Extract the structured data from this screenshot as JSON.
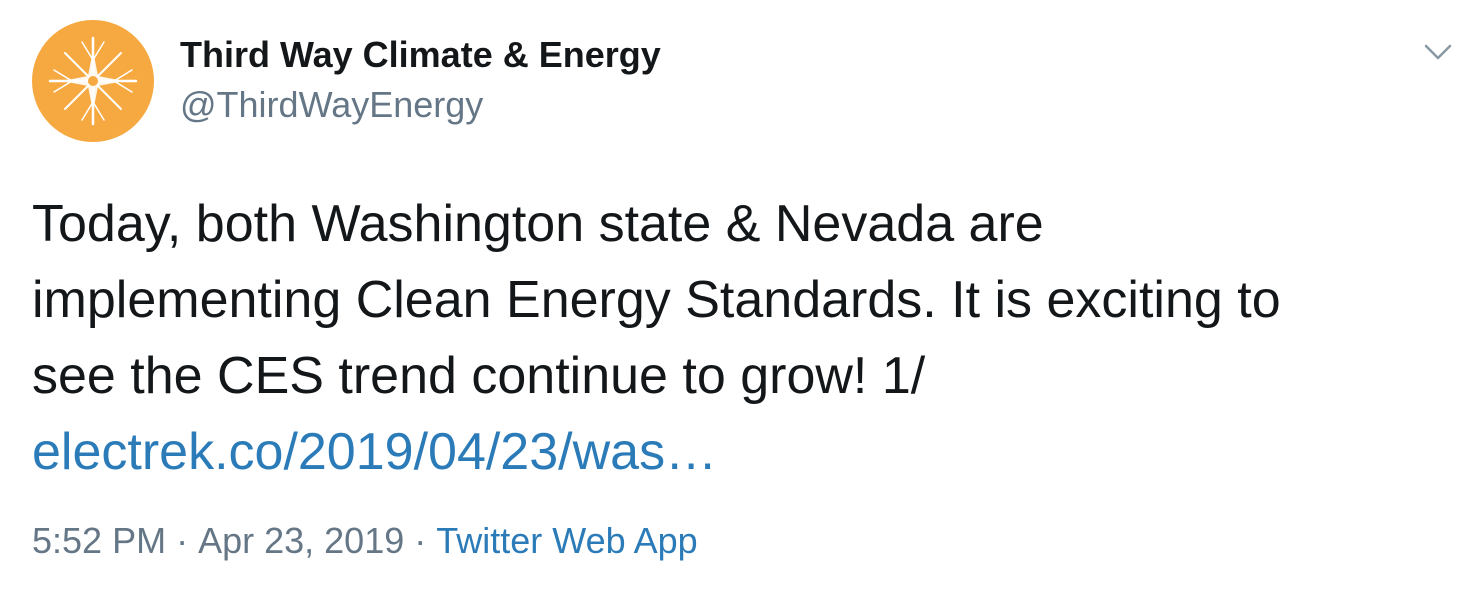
{
  "author": {
    "display_name": "Third Way Climate & Energy",
    "handle": "@ThirdWayEnergy",
    "avatar_icon": "sunburst-logo-icon",
    "avatar_color": "#f7a941"
  },
  "menu": {
    "icon": "chevron-down-icon"
  },
  "tweet": {
    "lines": [
      "Today, both Washington state & Nevada are",
      "implementing Clean Energy Standards. It is exciting to",
      "see the CES trend continue to grow! 1/"
    ],
    "link_text": "electrek.co/2019/04/23/was…"
  },
  "meta": {
    "time": "5:52 PM",
    "separator": "·",
    "date": "Apr 23, 2019",
    "source": "Twitter Web App"
  },
  "colors": {
    "text": "#14171a",
    "secondary": "#657786",
    "link": "#2b7bb9"
  }
}
